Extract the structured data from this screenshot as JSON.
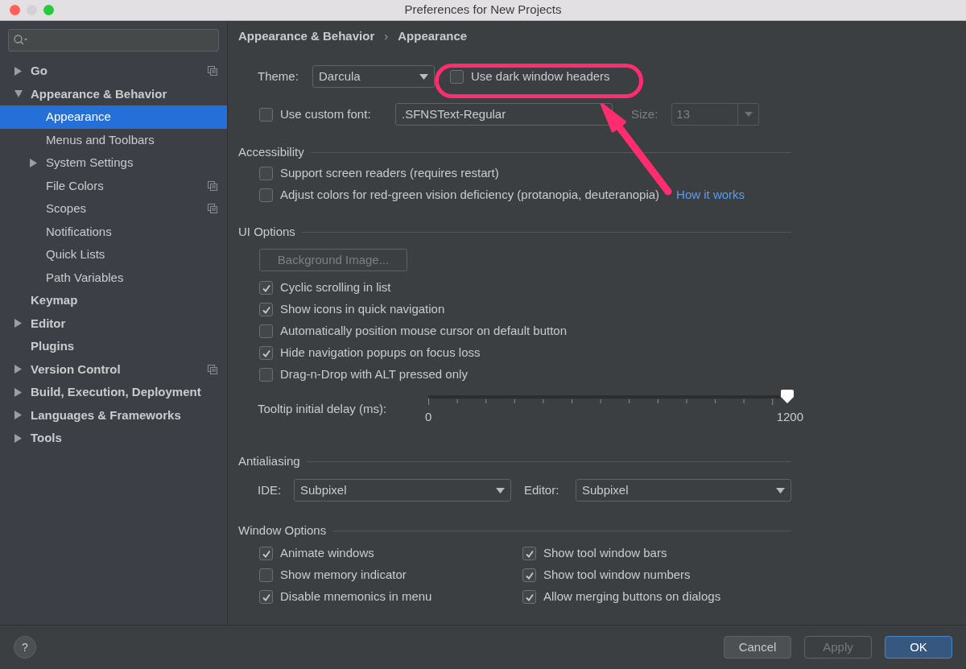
{
  "window": {
    "title": "Preferences for New Projects"
  },
  "sidebar": {
    "items": [
      {
        "label": "Go",
        "expanded": false,
        "shared": true,
        "selected": false
      },
      {
        "label": "Appearance & Behavior",
        "expanded": true,
        "shared": false,
        "selected": false,
        "children": [
          {
            "label": "Appearance",
            "shared": false,
            "selected": true
          },
          {
            "label": "Menus and Toolbars",
            "shared": false,
            "selected": false
          },
          {
            "label": "System Settings",
            "expanded": false,
            "shared": false,
            "selected": false
          },
          {
            "label": "File Colors",
            "shared": true,
            "selected": false
          },
          {
            "label": "Scopes",
            "shared": true,
            "selected": false
          },
          {
            "label": "Notifications",
            "shared": false,
            "selected": false
          },
          {
            "label": "Quick Lists",
            "shared": false,
            "selected": false
          },
          {
            "label": "Path Variables",
            "shared": false,
            "selected": false
          }
        ]
      },
      {
        "label": "Keymap",
        "shared": false,
        "selected": false
      },
      {
        "label": "Editor",
        "expanded": false,
        "shared": false,
        "selected": false
      },
      {
        "label": "Plugins",
        "shared": false,
        "selected": false
      },
      {
        "label": "Version Control",
        "expanded": false,
        "shared": true,
        "selected": false
      },
      {
        "label": "Build, Execution, Deployment",
        "expanded": false,
        "shared": false,
        "selected": false
      },
      {
        "label": "Languages & Frameworks",
        "expanded": false,
        "shared": false,
        "selected": false
      },
      {
        "label": "Tools",
        "expanded": false,
        "shared": false,
        "selected": false
      }
    ]
  },
  "breadcrumb": {
    "items": [
      "Appearance & Behavior",
      "Appearance"
    ],
    "separator": "›"
  },
  "theme": {
    "label": "Theme:",
    "value": "Darcula",
    "dark_headers": {
      "label": "Use dark window headers",
      "checked": false
    }
  },
  "custom_font": {
    "label": "Use custom font:",
    "checked": false,
    "value": ".SFNSText-Regular",
    "size_label": "Size:",
    "size_value": "13"
  },
  "accessibility": {
    "title": "Accessibility",
    "items": [
      {
        "label": "Support screen readers (requires restart)",
        "checked": false
      },
      {
        "label": "Adjust colors for red-green vision deficiency (protanopia, deuteranopia)",
        "checked": false,
        "link": "How it works"
      }
    ]
  },
  "ui_options": {
    "title": "UI Options",
    "background_button": {
      "label": "Background Image...",
      "disabled": true
    },
    "items": [
      {
        "label": "Cyclic scrolling in list",
        "checked": true
      },
      {
        "label": "Show icons in quick navigation",
        "checked": true
      },
      {
        "label": "Automatically position mouse cursor on default button",
        "checked": false
      },
      {
        "label": "Hide navigation popups on focus loss",
        "checked": true
      },
      {
        "label": "Drag-n-Drop with ALT pressed only",
        "checked": false
      }
    ],
    "tooltip_delay": {
      "label": "Tooltip initial delay (ms):",
      "level": 1,
      "min": "0",
      "max": "1200"
    }
  },
  "antialiasing": {
    "title": "Antialiasing",
    "ide_label": "IDE:",
    "ide_value": "Subpixel",
    "editor_label": "Editor:",
    "editor_value": "Subpixel"
  },
  "window_options": {
    "title": "Window Options",
    "left": [
      {
        "label": "Animate windows",
        "checked": true
      },
      {
        "label": "Show memory indicator",
        "checked": false
      },
      {
        "label": "Disable mnemonics in menu",
        "checked": true
      }
    ],
    "right": [
      {
        "label": "Show tool window bars",
        "checked": true
      },
      {
        "label": "Show tool window numbers",
        "checked": true
      },
      {
        "label": "Allow merging buttons on dialogs",
        "checked": true
      }
    ]
  },
  "footer": {
    "help": "?",
    "buttons": [
      {
        "label": "Cancel",
        "kind": "normal",
        "disabled": false
      },
      {
        "label": "Apply",
        "kind": "normal",
        "disabled": true
      },
      {
        "label": "OK",
        "kind": "default",
        "disabled": false
      }
    ]
  }
}
